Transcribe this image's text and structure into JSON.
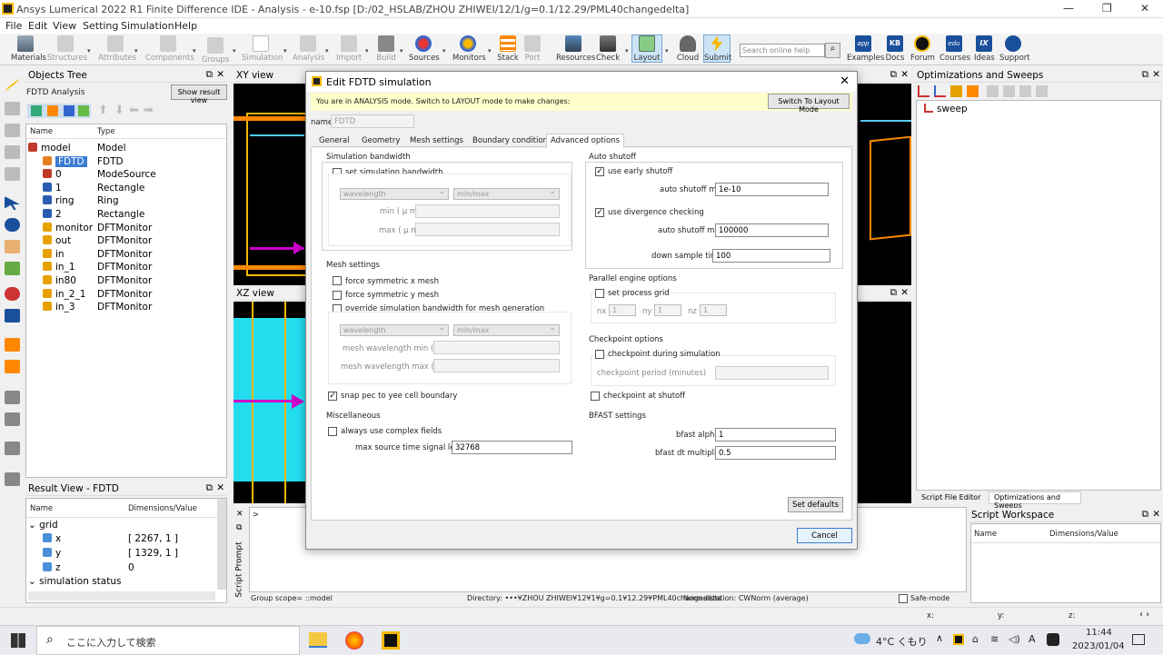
{
  "window": {
    "title": "Ansys Lumerical 2022 R1 Finite Difference IDE - Analysis - e-10.fsp [D:/02_HSLAB/ZHOU ZHIWEI/12/1/g=0.1/12.29/PML40changedelta]",
    "minimize": "—",
    "restore": "❐",
    "close": "✕"
  },
  "menu": [
    "File",
    "Edit",
    "View",
    "Setting",
    "Simulation",
    "Help"
  ],
  "toolbar": {
    "materials": "Materials",
    "structures": "Structures",
    "attributes": "Attributes",
    "components": "Components",
    "groups": "Groups",
    "simulation": "Simulation",
    "analysis": "Analysis",
    "import": "Import",
    "build": "Build",
    "sources": "Sources",
    "monitors": "Monitors",
    "stack": "Stack",
    "port": "Port",
    "resources": "Resources",
    "check": "Check",
    "layout": "Layout",
    "cloud": "Cloud",
    "submit": "Submit",
    "search_placeholder": "Search online help",
    "examples": "Examples",
    "docs": "Docs",
    "forum": "Forum",
    "courses": "Courses",
    "ideas": "Ideas",
    "support": "Support",
    "app_badge": "app",
    "kb_badge": "KB",
    "edu_badge": "edu",
    "ix_badge": "IX"
  },
  "objects_tree": {
    "title": "Objects Tree",
    "analysis_label": "FDTD Analysis",
    "show_result_view": "Show result view",
    "col_name": "Name",
    "col_type": "Type",
    "rows": [
      {
        "name": "model",
        "type": "Model",
        "color": "#c0392b"
      },
      {
        "name": "FDTD",
        "type": "FDTD",
        "color": "#e67e22"
      },
      {
        "name": "0",
        "type": "ModeSource",
        "color": "#c0392b"
      },
      {
        "name": "1",
        "type": "Rectangle",
        "color": "#2a5db0"
      },
      {
        "name": "ring",
        "type": "Ring",
        "color": "#2a5db0"
      },
      {
        "name": "2",
        "type": "Rectangle",
        "color": "#2a5db0"
      },
      {
        "name": "monitor",
        "type": "DFTMonitor",
        "color": "#e6a100"
      },
      {
        "name": "out",
        "type": "DFTMonitor",
        "color": "#e6a100"
      },
      {
        "name": "in",
        "type": "DFTMonitor",
        "color": "#e6a100"
      },
      {
        "name": "in_1",
        "type": "DFTMonitor",
        "color": "#e6a100"
      },
      {
        "name": "in80",
        "type": "DFTMonitor",
        "color": "#e6a100"
      },
      {
        "name": "in_2_1",
        "type": "DFTMonitor",
        "color": "#e6a100"
      },
      {
        "name": "in_3",
        "type": "DFTMonitor",
        "color": "#e6a100"
      }
    ]
  },
  "result_view": {
    "title": "Result View - FDTD",
    "col_name": "Name",
    "col_value": "Dimensions/Value",
    "grid_label": "grid",
    "rows": [
      {
        "name": "x",
        "value": "[ 2267, 1 ]"
      },
      {
        "name": "y",
        "value": "[ 1329, 1 ]"
      },
      {
        "name": "z",
        "value": "0"
      }
    ],
    "sim_status": "simulation status"
  },
  "views": {
    "xy": "XY view",
    "xz": "XZ view"
  },
  "script_prompt": {
    "label": "Script Prompt",
    "prompt": ">"
  },
  "status_bar": {
    "group_scope": "Group scope= ::model",
    "directory": "Directory: •••¥ZHOU ZHIWEI¥12¥1¥g=0.1¥12.29¥PML40changedelta",
    "normalization": "Normalization: CWNorm (average)",
    "safe_mode": "Safe-mode",
    "x": "x:",
    "y": "y:",
    "z": "z:"
  },
  "opt_sweeps": {
    "title": "Optimizations and Sweeps",
    "item": "sweep",
    "tab_script": "Script File Editor",
    "tab_opt": "Optimizations and Sweeps"
  },
  "script_workspace": {
    "title": "Script Workspace",
    "col_name": "Name",
    "col_value": "Dimensions/Value"
  },
  "dialog": {
    "title": "Edit FDTD simulation",
    "notice": "You are in ANALYSIS mode.  Switch to LAYOUT mode to make changes:",
    "switch_btn": "Switch To Layout Mode",
    "name_label": "name",
    "name_value": "FDTD",
    "tabs": [
      "General",
      "Geometry",
      "Mesh settings",
      "Boundary conditions",
      "Advanced options"
    ],
    "sim_bandwidth": {
      "title": "Simulation bandwidth",
      "set_label": "set simulation bandwidth",
      "sel1": "wavelength",
      "sel2": "min/max",
      "min_label": "min ( μ m)",
      "max_label": "max ( μ m)"
    },
    "mesh_settings": {
      "title": "Mesh settings",
      "force_x": "force symmetric x mesh",
      "force_y": "force symmetric y mesh",
      "override": "override simulation bandwidth for mesh generation",
      "sel1": "wavelength",
      "sel2": "min/max",
      "min_label": "mesh wavelength min ( μ m)",
      "max_label": "mesh wavelength max ( μ m)",
      "snap": "snap pec to yee cell boundary"
    },
    "misc": {
      "title": "Miscellaneous",
      "complex": "always use complex fields",
      "max_src_label": "max source time signal length",
      "max_src_value": "32768"
    },
    "auto_shutoff": {
      "title": "Auto shutoff",
      "early": "use early shutoff",
      "min_label": "auto shutoff min",
      "min_value": "1e-10",
      "divergence": "use divergence checking",
      "max_label": "auto shutoff max",
      "max_value": "100000",
      "down_label": "down sample time",
      "down_value": "100"
    },
    "parallel": {
      "title": "Parallel engine options",
      "set_grid": "set process grid",
      "nx": "nx",
      "ny": "ny",
      "nz": "nz",
      "val": "1"
    },
    "checkpoint": {
      "title": "Checkpoint options",
      "during": "checkpoint during simulation",
      "period": "checkpoint period (minutes)",
      "at_shutoff": "checkpoint at shutoff"
    },
    "bfast": {
      "title": "BFAST settings",
      "alpha_label": "bfast alpha",
      "alpha_value": "1",
      "dt_label": "bfast dt multiplier",
      "dt_value": "0.5"
    },
    "set_defaults": "Set defaults",
    "cancel": "Cancel",
    "check_mark": "✓"
  },
  "taskbar": {
    "search": "ここに入力して検索",
    "weather": "4°C  くもり",
    "time": "11:44",
    "date": "2023/01/04",
    "ime": "A"
  }
}
